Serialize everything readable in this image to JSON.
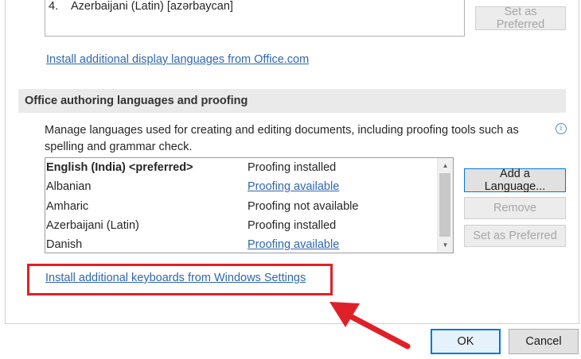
{
  "display_languages": {
    "items": [
      {
        "number": "4.",
        "label": "Azerbaijani (Latin) [azərbaycan]"
      }
    ],
    "set_preferred_label": "Set as Preferred",
    "install_link": "Install additional display languages from Office.com"
  },
  "authoring": {
    "header": "Office authoring languages and proofing",
    "description": "Manage languages used for creating and editing documents, including proofing tools such as spelling and grammar check.",
    "info_icon": "info-icon",
    "languages": [
      {
        "name": "English (India) <preferred>",
        "status": "Proofing installed",
        "status_is_link": false,
        "bold": true
      },
      {
        "name": "Albanian",
        "status": "Proofing available",
        "status_is_link": true,
        "bold": false
      },
      {
        "name": "Amharic",
        "status": "Proofing not available",
        "status_is_link": false,
        "bold": false
      },
      {
        "name": "Azerbaijani (Latin)",
        "status": "Proofing installed",
        "status_is_link": false,
        "bold": false
      },
      {
        "name": "Danish",
        "status": "Proofing available",
        "status_is_link": true,
        "bold": false
      }
    ],
    "buttons": {
      "add": "Add a Language...",
      "remove": "Remove",
      "set_preferred": "Set as Preferred"
    },
    "keyboards_link": "Install additional keyboards from Windows Settings"
  },
  "footer": {
    "ok": "OK",
    "cancel": "Cancel"
  },
  "colors": {
    "highlight": "#e02028",
    "arrow": "#e02028",
    "link": "#2f67ad",
    "accent": "#0078d7"
  }
}
